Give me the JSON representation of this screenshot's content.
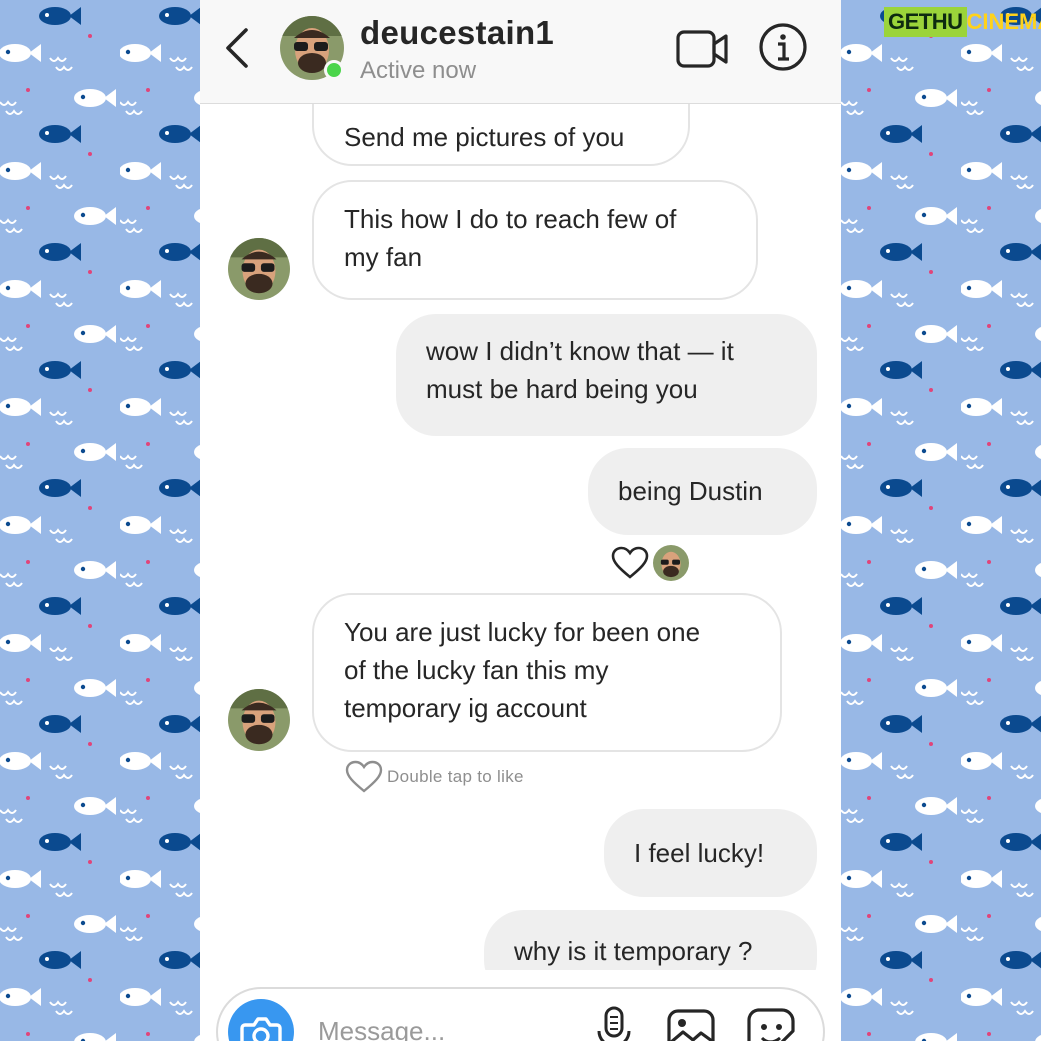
{
  "header": {
    "username": "deucestain1",
    "status": "Active now",
    "online_color": "#4bd54b",
    "icons": [
      "back-chevron-icon",
      "video-camera-icon",
      "info-icon"
    ]
  },
  "messages": [
    {
      "from": "them",
      "text": "Send me pictures of you"
    },
    {
      "from": "them",
      "text": "This how I do to reach few of my fan",
      "lines": [
        "This how I do to reach few of",
        "my fan"
      ]
    },
    {
      "from": "me",
      "text": "wow I didn’t know that — it must be hard being you",
      "lines": [
        "wow I didn’t know that — it",
        "must be hard being you"
      ]
    },
    {
      "from": "me",
      "text": "being Dustin",
      "reactions": [
        "heart-icon",
        "avatar"
      ]
    },
    {
      "from": "them",
      "text": "You are just lucky for been one of the lucky fan this my temporary ig account",
      "lines": [
        "You are just lucky for been one",
        "of the lucky fan this my",
        "temporary ig account"
      ]
    },
    {
      "from": "me",
      "text": "I feel lucky!"
    },
    {
      "from": "me",
      "text": "why is it temporary ?"
    }
  ],
  "like_hint": "Double tap to like",
  "composer": {
    "placeholder": "Message...",
    "accent": "#3897f0",
    "icons": [
      "camera-icon",
      "microphone-icon",
      "gallery-icon",
      "sticker-icon"
    ]
  },
  "watermark": {
    "part1": "GETHU",
    "part2": "CINEMA"
  },
  "background": {
    "color": "#98b8e6",
    "fish_dark": "#0b4a8f",
    "fish_light": "#ffffff"
  }
}
